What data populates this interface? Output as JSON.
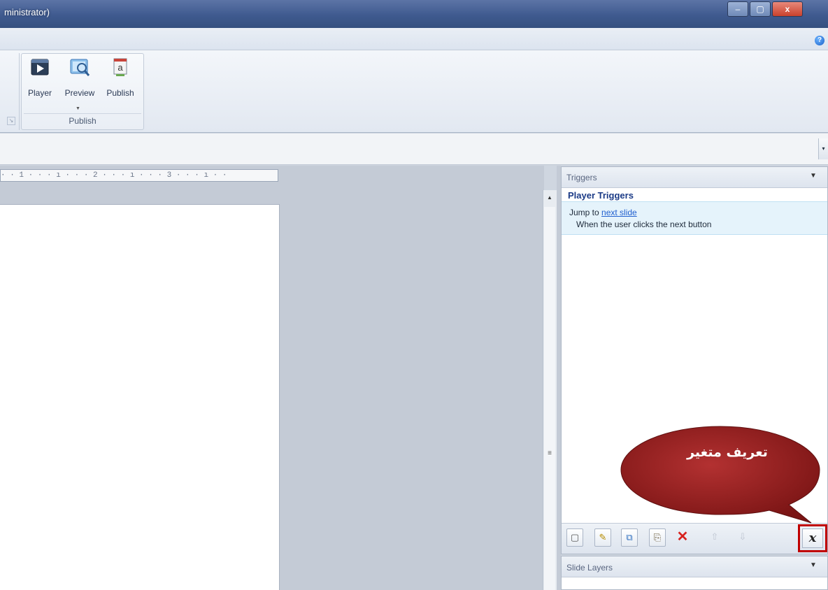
{
  "window": {
    "title": "ministrator)",
    "min_label": "–",
    "max_label": "▢",
    "close_label": "x"
  },
  "ribbon": {
    "help_label": "?",
    "left_launcher": "↘",
    "buttons": [
      {
        "label": "Player",
        "icon": "player-icon"
      },
      {
        "label": "Preview",
        "icon": "preview-icon"
      },
      {
        "label": "Publish",
        "icon": "publish-icon"
      }
    ],
    "preview_arrow": "▼",
    "group_label": "Publish"
  },
  "strip": {
    "dropdown": "▾"
  },
  "ruler": {
    "text": "· · 1 · · · ı · · · 2 · · · ı · · · 3 · · · ı · ·"
  },
  "scrollbar": {
    "up": "▲",
    "thumb": "≡"
  },
  "triggers": {
    "title": "Triggers",
    "menu": "▼",
    "group": "Player Triggers",
    "item": {
      "action_prefix": "Jump to ",
      "action_link": "next slide",
      "condition": "When the user clicks the next button"
    },
    "toolbar": {
      "new": "▢",
      "edit": "✎",
      "copy": "⧉",
      "paste": "⎘",
      "delete": "✕",
      "up": "⇧",
      "down": "⇩",
      "variables": "x"
    }
  },
  "layers": {
    "title": "Slide Layers",
    "menu": "▼"
  },
  "callout": {
    "text": "تعريف متغير",
    "color": "#8e1c1c"
  }
}
